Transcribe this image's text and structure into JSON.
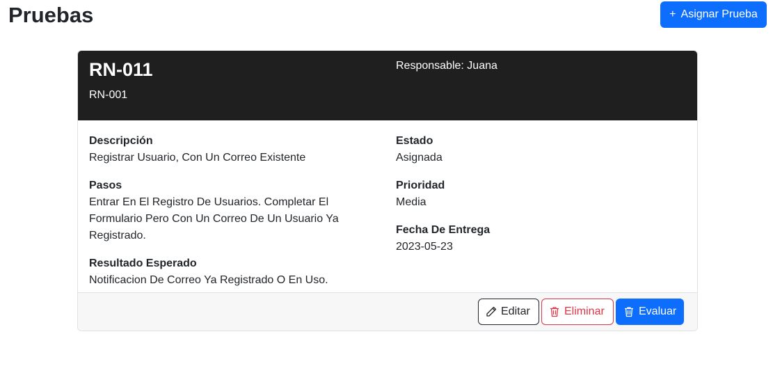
{
  "header": {
    "title": "Pruebas",
    "assign_button_label": "Asignar Prueba"
  },
  "card": {
    "code": "RN-011",
    "subcode": "RN-001",
    "responsible": "Responsable: Juana",
    "fields_left": [
      {
        "label": "Descripción",
        "value": "Registrar Usuario, Con Un Correo Existente"
      },
      {
        "label": "Pasos",
        "value": "Entrar En El Registro De Usuarios. Completar El Formulario Pero Con Un Correo De Un Usuario Ya Registrado."
      },
      {
        "label": "Resultado Esperado",
        "value": "Notificacion De Correo Ya Registrado O En Uso."
      }
    ],
    "fields_right": [
      {
        "label": "Estado",
        "value": "Asignada"
      },
      {
        "label": "Prioridad",
        "value": "Media"
      },
      {
        "label": "Fecha De Entrega",
        "value": "2023-05-23"
      }
    ],
    "actions": {
      "edit_label": "Editar",
      "delete_label": "Eliminar",
      "evaluate_label": "Evaluar"
    }
  },
  "icons": {
    "assign": "plus-icon",
    "edit": "pencil-icon",
    "delete": "trash-icon",
    "evaluate": "trash-icon"
  },
  "colors": {
    "primary": "#0d6efd",
    "danger": "#dc3545",
    "header_bg": "#1f1f1f",
    "footer_bg": "#f7f7f7"
  }
}
